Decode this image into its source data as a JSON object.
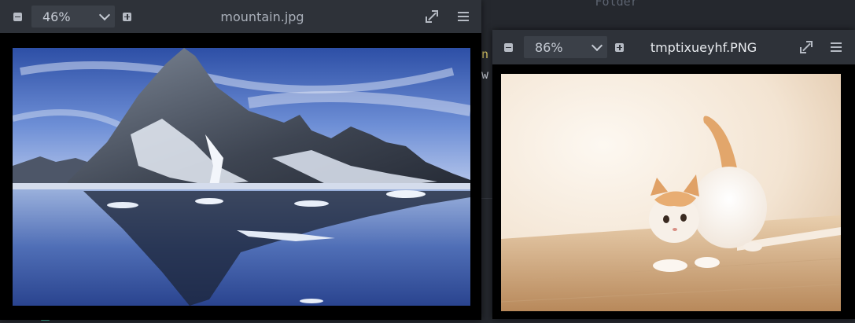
{
  "background_editor": {
    "line_1": "Folder",
    "line_2": "",
    "line_3": "n",
    "line_4": "w",
    "line_5": ""
  },
  "viewers": [
    {
      "title": "mountain.jpg",
      "zoom": "46%",
      "icons": [
        "minus-icon",
        "plus-icon",
        "chevron-down-icon",
        "expand-icon",
        "menu-icon"
      ]
    },
    {
      "title": "tmptixueyhf.PNG",
      "zoom": "86%",
      "icons": [
        "minus-icon",
        "plus-icon",
        "chevron-down-icon",
        "expand-icon",
        "menu-icon"
      ]
    }
  ],
  "colors": {
    "toolbar_bg": "#2e3239",
    "zoom_bg": "#3b4048",
    "editor_bg": "#25282e",
    "viewer_bg": "#000000"
  }
}
